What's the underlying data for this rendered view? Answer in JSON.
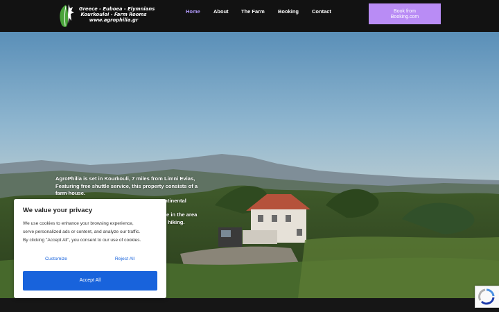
{
  "header": {
    "logo_lines": [
      "Greece - Euboea - Elymnians",
      "Kourkouloi - Farm Rooms",
      "www.agrophilia.gr"
    ],
    "nav": [
      {
        "label": "Home",
        "active": true
      },
      {
        "label": "About",
        "active": false
      },
      {
        "label": "The Farm",
        "active": false
      },
      {
        "label": "Booking",
        "active": false
      },
      {
        "label": "Contact",
        "active": false
      }
    ],
    "book_button": {
      "line1": "Book from",
      "line2": "Booking.com"
    }
  },
  "hero": {
    "lines": [
      "AgroPhilia is set in Kourkouli, 7 miles from Limni Evias,",
      "Featuring free shuttle service, this property consists of a",
      "farm house.",
      "a continental",
      "e in the area",
      "hiking."
    ]
  },
  "cookie": {
    "title": "We value your privacy",
    "body": [
      "We use cookies to enhance your browsing experience,",
      "serve personalized ads or content, and analyze our traffic.",
      "By clicking \"Accept All\", you consent to our use of cookies."
    ],
    "customize": "Customize",
    "reject": "Reject All",
    "accept": "Accept All"
  },
  "colors": {
    "header_bg": "#121212",
    "nav_active": "#b49cff",
    "book_button_bg": "#b98cf5",
    "cookie_accent": "#1863dc"
  },
  "icons": {
    "logo": "goat-leaf-logo",
    "recaptcha": "recaptcha-icon"
  }
}
